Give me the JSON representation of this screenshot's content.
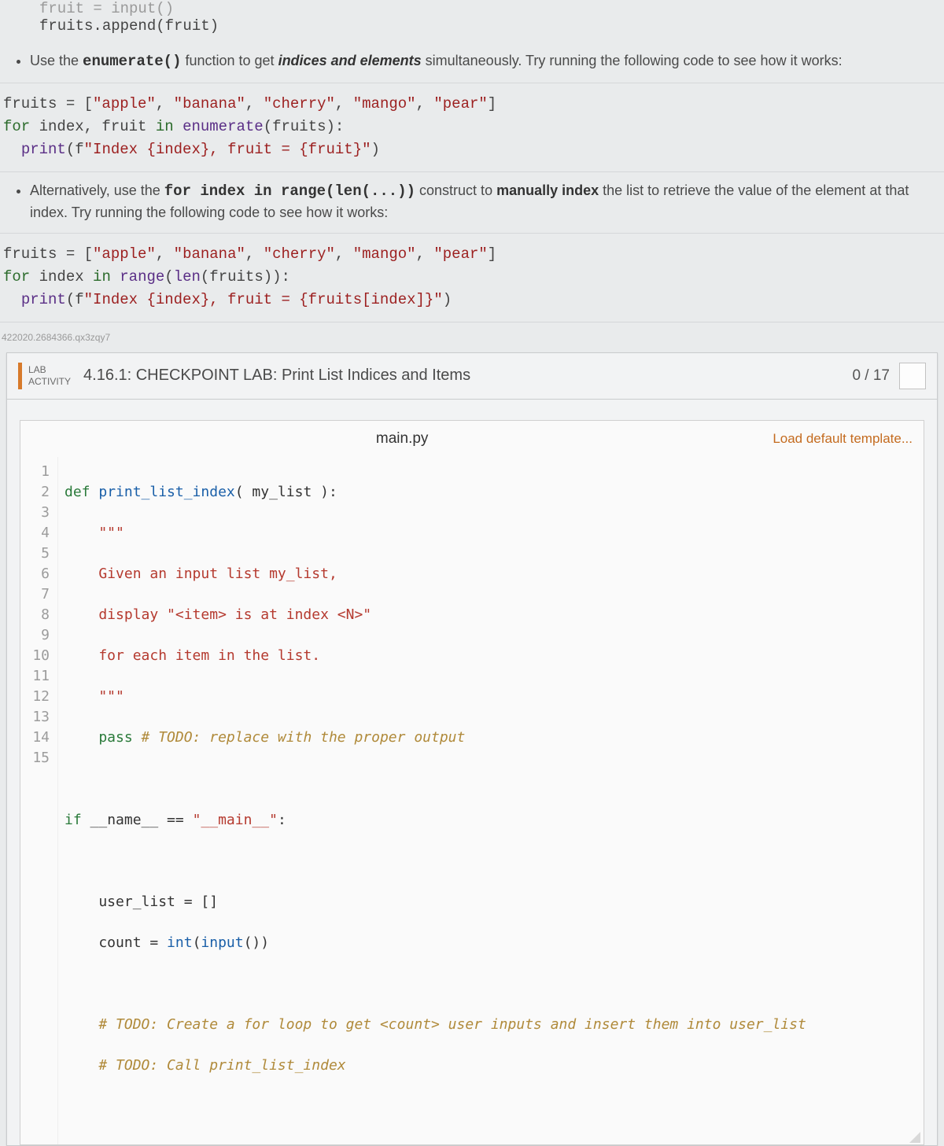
{
  "snippet_top": {
    "line1_faded": "fruit = input()",
    "line2": "fruits.append(fruit)"
  },
  "bullets": {
    "b1_pre": "Use the ",
    "b1_code": "enumerate()",
    "b1_mid": " function to get ",
    "b1_ital": "indices and elements",
    "b1_post": " simultaneously. Try running the following code to see how it works:",
    "b2_pre": "Alternatively, use the ",
    "b2_code": "for index in range(len(...))",
    "b2_mid": " construct to ",
    "b2_bold": "manually index",
    "b2_post1": " the list to retrieve the value of the element at that index. Try running the following code to see how it works:"
  },
  "codeblock1": {
    "l1a": "fruits = [",
    "l1s1": "\"apple\"",
    "l1c1": ", ",
    "l1s2": "\"banana\"",
    "l1c2": ", ",
    "l1s3": "\"cherry\"",
    "l1c3": ", ",
    "l1s4": "\"mango\"",
    "l1c4": ", ",
    "l1s5": "\"pear\"",
    "l1b": "]",
    "l2a": "for",
    "l2b": " index, fruit ",
    "l2c": "in",
    "l2d": " ",
    "l2fn": "enumerate",
    "l2e": "(fruits):",
    "l3a": "  ",
    "l3fn": "print",
    "l3b": "(f",
    "l3s": "\"Index {index}, fruit = {fruit}\"",
    "l3c": ")"
  },
  "codeblock2": {
    "l1a": "fruits = [",
    "l1s1": "\"apple\"",
    "l1c1": ", ",
    "l1s2": "\"banana\"",
    "l1c2": ", ",
    "l1s3": "\"cherry\"",
    "l1c3": ", ",
    "l1s4": "\"mango\"",
    "l1c4": ", ",
    "l1s5": "\"pear\"",
    "l1b": "]",
    "l2a": "for",
    "l2b": " index ",
    "l2c": "in",
    "l2d": " ",
    "l2fn1": "range",
    "l2e": "(",
    "l2fn2": "len",
    "l2f": "(fruits)):",
    "l3a": "  ",
    "l3fn": "print",
    "l3b": "(f",
    "l3s": "\"Index {index}, fruit = {fruits[index]}\"",
    "l3c": ")"
  },
  "ref_id": "422020.2684366.qx3zqy7",
  "lab": {
    "badge_line1": "LAB",
    "badge_line2": "ACTIVITY",
    "title": "4.16.1: CHECKPOINT LAB: Print List Indices and Items",
    "score": "0 / 17"
  },
  "editor": {
    "filename": "main.py",
    "load_template": "Load default template...",
    "lines": [
      "1",
      "2",
      "3",
      "4",
      "5",
      "6",
      "7",
      "8",
      "9",
      "10",
      "11",
      "12",
      "13",
      "14",
      "15"
    ]
  },
  "code": {
    "l1_kw": "def",
    "l1_fn": " print_list_index",
    "l1_rest": "( my_list ):",
    "l2": "    \"\"\"",
    "l3": "    Given an input list my_list,",
    "l4": "    display \"<item> is at index <N>\"",
    "l5": "    for each item in the list.",
    "l6": "    \"\"\"",
    "l7_kw": "    pass",
    "l7_com": " # TODO: replace with the proper output",
    "l8": "",
    "l9_kw1": "if",
    "l9_mid": " __name__ == ",
    "l9_str": "\"__main__\"",
    "l9_colon": ":",
    "l10": "",
    "l11": "    user_list = []",
    "l12a": "    count = ",
    "l12fn": "int",
    "l12b": "(",
    "l12fn2": "input",
    "l12c": "())",
    "l13": "",
    "l14": "    # TODO: Create a for loop to get <count> user inputs and insert them into user_list",
    "l15": "    # TODO: Call print_list_index"
  }
}
